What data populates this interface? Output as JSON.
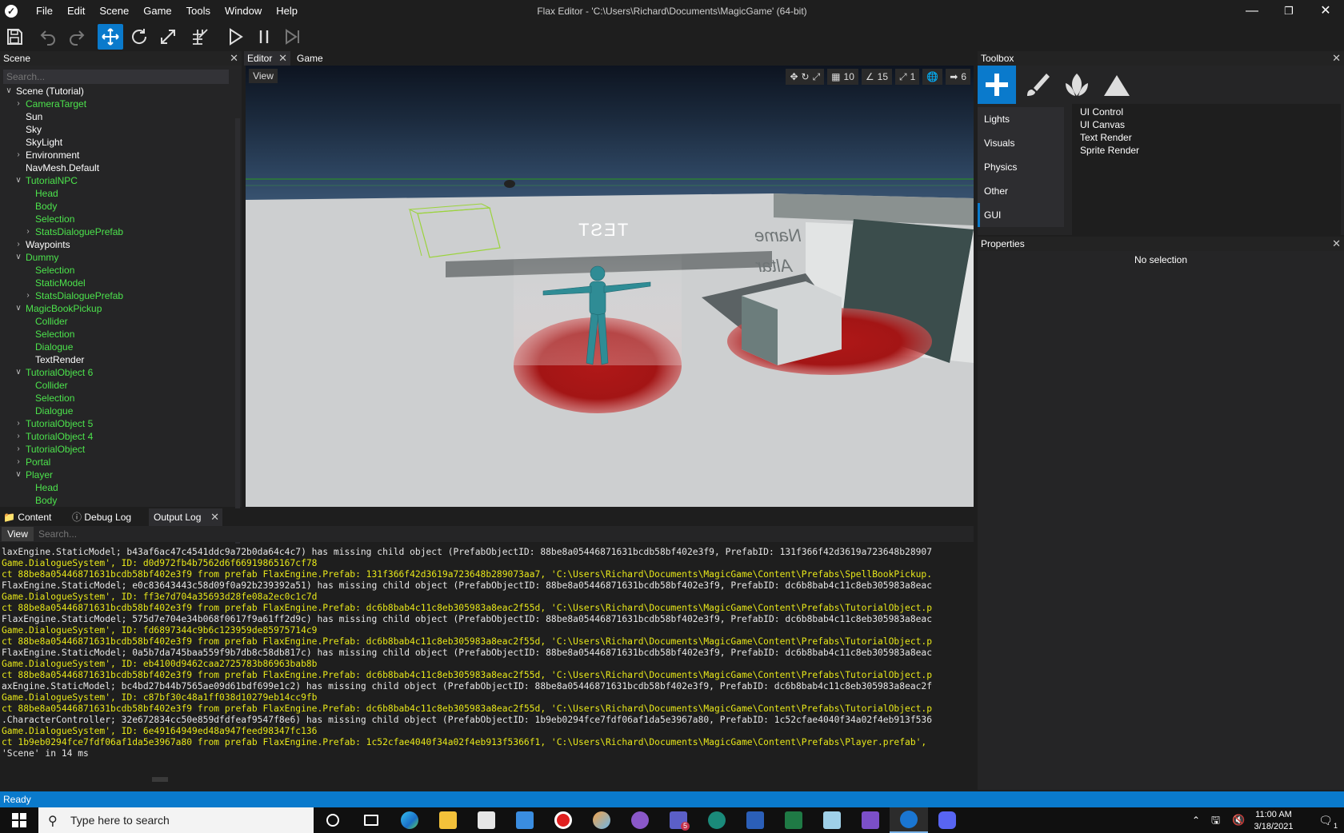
{
  "window": {
    "title": "Flax Editor - 'C:\\Users\\Richard\\Documents\\MagicGame' (64-bit)",
    "menu": [
      "File",
      "Edit",
      "Scene",
      "Game",
      "Tools",
      "Window",
      "Help"
    ]
  },
  "scene_panel": {
    "title": "Scene",
    "search_placeholder": "Search...",
    "tree": [
      {
        "label": "Scene (Tutorial)",
        "depth": 0,
        "arrow": "open",
        "prefab": false
      },
      {
        "label": "CameraTarget",
        "depth": 1,
        "arrow": "closed",
        "prefab": true
      },
      {
        "label": "Sun",
        "depth": 1,
        "arrow": "none",
        "prefab": false
      },
      {
        "label": "Sky",
        "depth": 1,
        "arrow": "none",
        "prefab": false
      },
      {
        "label": "SkyLight",
        "depth": 1,
        "arrow": "none",
        "prefab": false
      },
      {
        "label": "Environment",
        "depth": 1,
        "arrow": "closed",
        "prefab": false
      },
      {
        "label": "NavMesh.Default",
        "depth": 1,
        "arrow": "none",
        "prefab": false
      },
      {
        "label": "TutorialNPC",
        "depth": 1,
        "arrow": "open",
        "prefab": true
      },
      {
        "label": "Head",
        "depth": 2,
        "arrow": "none",
        "prefab": true
      },
      {
        "label": "Body",
        "depth": 2,
        "arrow": "none",
        "prefab": true
      },
      {
        "label": "Selection",
        "depth": 2,
        "arrow": "none",
        "prefab": true
      },
      {
        "label": "StatsDialoguePrefab",
        "depth": 2,
        "arrow": "closed",
        "prefab": true
      },
      {
        "label": "Waypoints",
        "depth": 1,
        "arrow": "closed",
        "prefab": false
      },
      {
        "label": "Dummy",
        "depth": 1,
        "arrow": "open",
        "prefab": true
      },
      {
        "label": "Selection",
        "depth": 2,
        "arrow": "none",
        "prefab": true
      },
      {
        "label": "StaticModel",
        "depth": 2,
        "arrow": "none",
        "prefab": true
      },
      {
        "label": "StatsDialoguePrefab",
        "depth": 2,
        "arrow": "closed",
        "prefab": true
      },
      {
        "label": "MagicBookPickup",
        "depth": 1,
        "arrow": "open",
        "prefab": true
      },
      {
        "label": "Collider",
        "depth": 2,
        "arrow": "none",
        "prefab": true
      },
      {
        "label": "Selection",
        "depth": 2,
        "arrow": "none",
        "prefab": true
      },
      {
        "label": "Dialogue",
        "depth": 2,
        "arrow": "none",
        "prefab": true
      },
      {
        "label": "TextRender",
        "depth": 2,
        "arrow": "none",
        "prefab": false
      },
      {
        "label": "TutorialObject 6",
        "depth": 1,
        "arrow": "open",
        "prefab": true
      },
      {
        "label": "Collider",
        "depth": 2,
        "arrow": "none",
        "prefab": true
      },
      {
        "label": "Selection",
        "depth": 2,
        "arrow": "none",
        "prefab": true
      },
      {
        "label": "Dialogue",
        "depth": 2,
        "arrow": "none",
        "prefab": true
      },
      {
        "label": "TutorialObject 5",
        "depth": 1,
        "arrow": "closed",
        "prefab": true
      },
      {
        "label": "TutorialObject 4",
        "depth": 1,
        "arrow": "closed",
        "prefab": true
      },
      {
        "label": "TutorialObject",
        "depth": 1,
        "arrow": "closed",
        "prefab": true
      },
      {
        "label": "Portal",
        "depth": 1,
        "arrow": "closed",
        "prefab": true
      },
      {
        "label": "Player",
        "depth": 1,
        "arrow": "open",
        "prefab": true
      },
      {
        "label": "Head",
        "depth": 2,
        "arrow": "none",
        "prefab": true
      },
      {
        "label": "Body",
        "depth": 2,
        "arrow": "none",
        "prefab": true
      }
    ]
  },
  "editor": {
    "tabs": [
      "Editor",
      "Game"
    ],
    "view_button": "View",
    "grid_snap": "10",
    "rotation_snap": "15",
    "scale_snap": "1",
    "camera_speed": "6",
    "world_text_1": "TEST",
    "world_text_2": "Name",
    "world_text_3": "Altar"
  },
  "toolbox": {
    "title": "Toolbox",
    "categories": [
      "Lights",
      "Visuals",
      "Physics",
      "Other",
      "GUI"
    ],
    "active_category": "GUI",
    "items": [
      "UI Control",
      "UI Canvas",
      "Text Render",
      "Sprite Render"
    ]
  },
  "properties": {
    "title": "Properties",
    "empty_text": "No selection"
  },
  "bottom": {
    "tabs": [
      "Content",
      "Debug Log",
      "Output Log"
    ],
    "view_button": "View",
    "search_placeholder": "Search...",
    "log_lines": [
      {
        "t": "laxEngine.StaticModel; b43af6ac47c4541ddc9a72b0da64c4c7) has missing child object (PrefabObjectID: 88be8a05446871631bcdb58bf402e3f9, PrefabID: 131f366f42d3619a723648b28907",
        "level": "info"
      },
      {
        "t": "Game.DialogueSystem', ID: d0d972fb4b7562d6f66919865167cf78",
        "level": "warn"
      },
      {
        "t": "ct 88be8a05446871631bcdb58bf402e3f9 from prefab FlaxEngine.Prefab: 131f366f42d3619a723648b289073aa7, 'C:\\Users\\Richard\\Documents\\MagicGame\\Content\\Prefabs\\SpellBookPickup.",
        "level": "warn"
      },
      {
        "t": "FlaxEngine.StaticModel; e0c83643443c58d09f0a92b239392a51) has missing child object (PrefabObjectID: 88be8a05446871631bcdb58bf402e3f9, PrefabID: dc6b8bab4c11c8eb305983a8eac",
        "level": "info"
      },
      {
        "t": "Game.DialogueSystem', ID: ff3e7d704a35693d28fe08a2ec0c1c7d",
        "level": "warn"
      },
      {
        "t": "ct 88be8a05446871631bcdb58bf402e3f9 from prefab FlaxEngine.Prefab: dc6b8bab4c11c8eb305983a8eac2f55d, 'C:\\Users\\Richard\\Documents\\MagicGame\\Content\\Prefabs\\TutorialObject.p",
        "level": "warn"
      },
      {
        "t": "FlaxEngine.StaticModel; 575d7e704e34b068f0617f9a61ff2d9c) has missing child object (PrefabObjectID: 88be8a05446871631bcdb58bf402e3f9, PrefabID: dc6b8bab4c11c8eb305983a8eac",
        "level": "info"
      },
      {
        "t": "Game.DialogueSystem', ID: fd6897344c9b6c123959de85975714c9",
        "level": "warn"
      },
      {
        "t": "ct 88be8a05446871631bcdb58bf402e3f9 from prefab FlaxEngine.Prefab: dc6b8bab4c11c8eb305983a8eac2f55d, 'C:\\Users\\Richard\\Documents\\MagicGame\\Content\\Prefabs\\TutorialObject.p",
        "level": "warn"
      },
      {
        "t": "FlaxEngine.StaticModel; 0a5b7da745baa559f9b7db8c58db817c) has missing child object (PrefabObjectID: 88be8a05446871631bcdb58bf402e3f9, PrefabID: dc6b8bab4c11c8eb305983a8eac",
        "level": "info"
      },
      {
        "t": "Game.DialogueSystem', ID: eb4100d9462caa2725783b86963bab8b",
        "level": "warn"
      },
      {
        "t": "ct 88be8a05446871631bcdb58bf402e3f9 from prefab FlaxEngine.Prefab: dc6b8bab4c11c8eb305983a8eac2f55d, 'C:\\Users\\Richard\\Documents\\MagicGame\\Content\\Prefabs\\TutorialObject.p",
        "level": "warn"
      },
      {
        "t": "axEngine.StaticModel; bc4bd27b44b7565ae09d61bdf699e1c2) has missing child object (PrefabObjectID: 88be8a05446871631bcdb58bf402e3f9, PrefabID: dc6b8bab4c11c8eb305983a8eac2f",
        "level": "info"
      },
      {
        "t": "Game.DialogueSystem', ID: c87bf30c48a1ff038d10279eb14cc9fb",
        "level": "warn"
      },
      {
        "t": "ct 88be8a05446871631bcdb58bf402e3f9 from prefab FlaxEngine.Prefab: dc6b8bab4c11c8eb305983a8eac2f55d, 'C:\\Users\\Richard\\Documents\\MagicGame\\Content\\Prefabs\\TutorialObject.p",
        "level": "warn"
      },
      {
        "t": ".CharacterController; 32e672834cc50e859dfdfeaf9547f8e6) has missing child object (PrefabObjectID: 1b9eb0294fce7fdf06af1da5e3967a80, PrefabID: 1c52cfae4040f34a02f4eb913f536",
        "level": "info"
      },
      {
        "t": "Game.DialogueSystem', ID: 6e49164949ed48a947feed98347fc136",
        "level": "warn"
      },
      {
        "t": "ct 1b9eb0294fce7fdf06af1da5e3967a80 from prefab FlaxEngine.Prefab: 1c52cfae4040f34a02f4eb913f5366f1, 'C:\\Users\\Richard\\Documents\\MagicGame\\Content\\Prefabs\\Player.prefab',",
        "level": "warn"
      },
      {
        "t": "'Scene' in 14 ms",
        "level": "info"
      }
    ]
  },
  "status": {
    "text": "Ready"
  },
  "taskbar": {
    "search_placeholder": "Type here to search",
    "time": "11:00 AM",
    "date": "3/18/2021",
    "teams_badge": "5",
    "notifications_badge": "1"
  },
  "colors": {
    "accent": "#0a7acc",
    "prefab_text": "#4ce34c",
    "log_warning": "#e7e71a"
  }
}
